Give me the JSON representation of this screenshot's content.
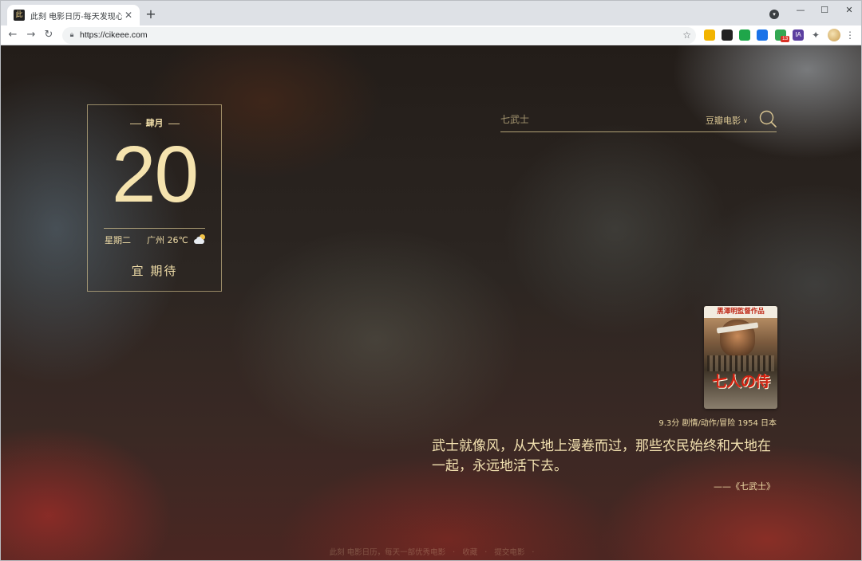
{
  "browser": {
    "tab_title": "此刻 电影日历-每天发现心电影",
    "favicon_char": "此",
    "tab_close": "✕",
    "new_tab": "+",
    "url": "https://cikeee.com",
    "window_controls": {
      "minimize": "—",
      "maximize": "☐",
      "close": "✕"
    },
    "extensions": [
      {
        "name": "bookmark-ext-icon",
        "color": "#f2b400"
      },
      {
        "name": "cat-ext-icon",
        "color": "#222222"
      },
      {
        "name": "check-ext-icon",
        "color": "#1fa64a"
      },
      {
        "name": "circle-ext-icon",
        "color": "#1a73e8"
      },
      {
        "name": "grid-ext-icon",
        "color": "#34a853",
        "badge": "13"
      },
      {
        "name": "ia-ext-icon",
        "color": "#5b3fa0",
        "label": "IA"
      },
      {
        "name": "puzzle-ext-icon",
        "color": "#5f6368"
      }
    ]
  },
  "calendar": {
    "month": "肆月",
    "day": "20",
    "weekday": "星期二",
    "weather": "广州 26℃",
    "weather_icon": "partly-cloudy-icon",
    "yi": "宜  期待"
  },
  "search": {
    "placeholder": "七武士",
    "source": "豆瓣电影"
  },
  "movie": {
    "poster_banner": "黑澤明監督作品",
    "poster_title": "七人の侍",
    "meta": "9.3分 剧情/动作/冒险 1954 日本",
    "quote": "武士就像风，从大地上漫卷而过，那些农民始终和大地在一起，永远地活下去。",
    "source": "——《七武士》"
  },
  "footer": {
    "text": "此刻 电影日历，每天一部优秀电影",
    "links": [
      "收藏",
      "提交电影"
    ]
  },
  "colors": {
    "accent": "#efdca7",
    "chrome_bg": "#dee1e6"
  }
}
